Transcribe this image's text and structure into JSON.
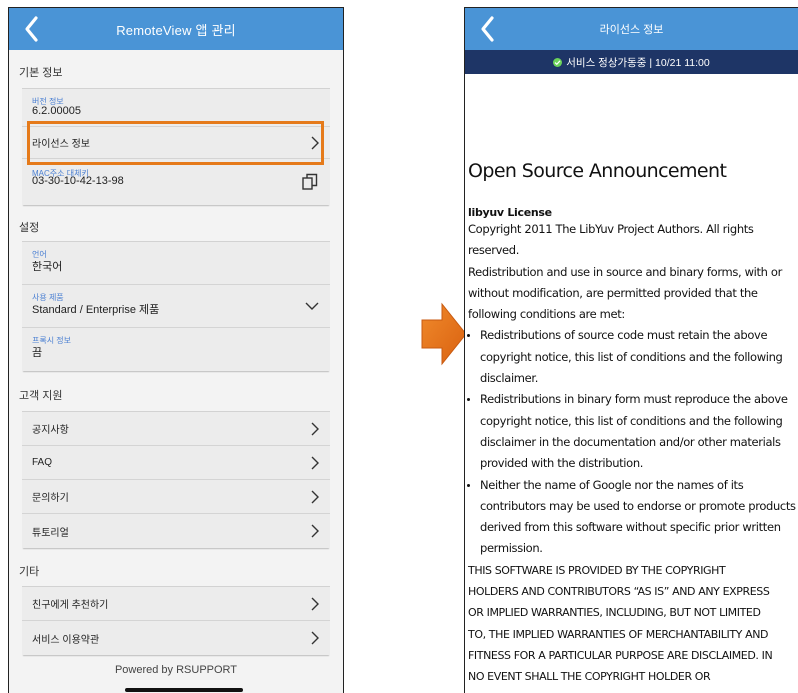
{
  "left_screen": {
    "header_title": "RemoteView 앱 관리",
    "sections": {
      "basic": "기본 정보",
      "settings": "설정",
      "support": "고객 지원",
      "etc": "기타"
    },
    "basic_rows": {
      "version_label": "버전 정보",
      "version_value": "6.2.00005",
      "license": "라이선스 정보",
      "mac_label": "MAC주소 대체키",
      "mac_value": "03-30-10-42-13-98"
    },
    "settings_rows": {
      "language_label": "언어",
      "language_value": "한국어",
      "product_label": "사용 제품",
      "product_value": "Standard / Enterprise 제품",
      "proxy_label": "프록시 정보",
      "proxy_value": "끔"
    },
    "support_rows": [
      "공지사항",
      "FAQ",
      "문의하기",
      "튜토리얼"
    ],
    "etc_rows": [
      "친구에게 추천하기",
      "서비스 이용약관"
    ],
    "footer": "Powered by RSUPPORT",
    "highlight_color": "#e57a1a"
  },
  "right_screen": {
    "header_title": "라이선스 정보",
    "status_text": "서비스 정상가동중 | 10/21 11:00",
    "doc_title": "Open Source Announcement",
    "license_name": "libyuv License",
    "copyright_lines": [
      "Copyright 2011 The LibYuv Project Authors. All rights",
      "reserved."
    ],
    "intro_lines": [
      "Redistribution and use in source and binary forms, with or",
      "without modification, are permitted provided that the",
      "following conditions are met:"
    ],
    "bullets": [
      "Redistributions of source code must retain the above copyright notice, this list of conditions and the following disclaimer.",
      "Redistributions in binary form must reproduce the above copyright notice, this list of conditions and the following disclaimer in the documentation and/or other materials provided with the distribution.",
      "Neither the name of Google nor the names of its contributors may be used to endorse or promote products derived from this software without specific prior written permission."
    ],
    "disclaimer_lines": [
      "THIS SOFTWARE IS PROVIDED BY THE COPYRIGHT",
      "HOLDERS AND CONTRIBUTORS “AS IS” AND ANY EXPRESS",
      "OR IMPLIED WARRANTIES, INCLUDING, BUT NOT LIMITED",
      "TO, THE IMPLIED WARRANTIES OF MERCHANTABILITY AND",
      "FITNESS FOR A PARTICULAR PURPOSE ARE DISCLAIMED. IN",
      "NO EVENT SHALL THE COPYRIGHT HOLDER OR"
    ]
  },
  "colors": {
    "header_blue": "#4a94d6",
    "status_navy": "#1e3566",
    "arrow_orange": "#e8711a",
    "label_blue": "#4a7fd2"
  }
}
